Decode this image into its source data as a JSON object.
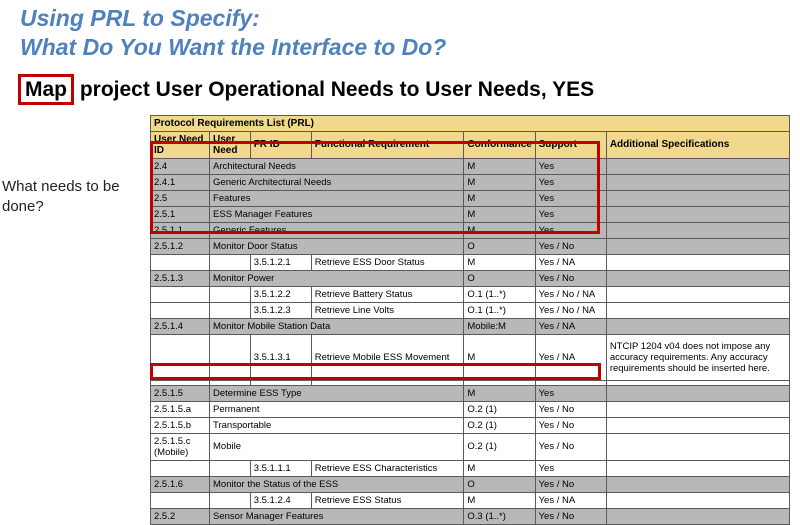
{
  "title": {
    "line1": "Using PRL to Specify:",
    "line2": "What Do You Want the Interface to Do?"
  },
  "subtitle": {
    "boxed": "Map",
    "rest": " project User Operational Needs to User Needs, YES"
  },
  "question": "What needs to be done?",
  "table": {
    "superheader": "Protocol Requirements List (PRL)",
    "columns": [
      "User Need ID",
      "User Need",
      "FR ID",
      "Functional Requirement",
      "Conformance",
      "Support",
      "Additional Specifications"
    ],
    "rows": [
      {
        "style": "shaded",
        "id": "2.4",
        "need": "Architectural Needs",
        "frid": "",
        "fr": "",
        "conf": "M",
        "sup": "Yes",
        "spec": ""
      },
      {
        "style": "shaded",
        "id": "2.4.1",
        "need": "Generic Architectural Needs",
        "frid": "",
        "fr": "",
        "conf": "M",
        "sup": "Yes",
        "spec": ""
      },
      {
        "style": "shaded",
        "id": "2.5",
        "need": "Features",
        "frid": "",
        "fr": "",
        "conf": "M",
        "sup": "Yes",
        "spec": ""
      },
      {
        "style": "shaded",
        "id": "2.5.1",
        "need": "ESS Manager Features",
        "frid": "",
        "fr": "",
        "conf": "M",
        "sup": "Yes",
        "spec": ""
      },
      {
        "style": "shaded",
        "id": "2.5.1.1",
        "need": "Generic Features",
        "frid": "",
        "fr": "",
        "conf": "M",
        "sup": "Yes",
        "spec": ""
      },
      {
        "style": "shaded",
        "id": "2.5.1.2",
        "need": "Monitor Door Status",
        "frid": "",
        "fr": "",
        "conf": "O",
        "sup": "Yes / No",
        "spec": ""
      },
      {
        "style": "white",
        "id": "",
        "need": "",
        "frid": "3.5.1.2.1",
        "fr": "Retrieve ESS Door Status",
        "conf": "M",
        "sup": "Yes / NA",
        "spec": ""
      },
      {
        "style": "shaded",
        "id": "2.5.1.3",
        "need": "Monitor Power",
        "frid": "",
        "fr": "",
        "conf": "O",
        "sup": "Yes / No",
        "spec": ""
      },
      {
        "style": "white",
        "id": "",
        "need": "",
        "frid": "3.5.1.2.2",
        "fr": "Retrieve Battery Status",
        "conf": "O.1 (1..*)",
        "sup": "Yes / No / NA",
        "spec": ""
      },
      {
        "style": "white",
        "id": "",
        "need": "",
        "frid": "3.5.1.2.3",
        "fr": "Retrieve Line Volts",
        "conf": "O.1 (1..*)",
        "sup": "Yes / No / NA",
        "spec": ""
      },
      {
        "style": "shaded",
        "id": "2.5.1.4",
        "need": "Monitor Mobile Station Data",
        "frid": "",
        "fr": "",
        "conf": "Mobile:M",
        "sup": "Yes / NA",
        "spec": ""
      },
      {
        "style": "white",
        "id": "",
        "need": "",
        "frid": "3.5.1.3.1",
        "fr": "Retrieve Mobile ESS Movement",
        "conf": "M",
        "sup": "Yes / NA",
        "spec": "NTCIP 1204 v04 does not impose any accuracy requirements. Any accuracy requirements should be inserted here.",
        "tall": true
      },
      {
        "style": "white",
        "id": "",
        "need": "",
        "frid": "",
        "fr": "",
        "conf": "",
        "sup": "",
        "spec": ""
      },
      {
        "style": "shaded",
        "id": "2.5.1.5",
        "need": "Determine ESS Type",
        "frid": "",
        "fr": "",
        "conf": "M",
        "sup": "Yes",
        "spec": ""
      },
      {
        "style": "white",
        "id": "2.5.1.5.a",
        "need": "Permanent",
        "frid": "",
        "fr": "",
        "conf": "O.2 (1)",
        "sup": "Yes / No",
        "spec": ""
      },
      {
        "style": "white",
        "id": "2.5.1.5.b",
        "need": "Transportable",
        "frid": "",
        "fr": "",
        "conf": "O.2 (1)",
        "sup": "Yes / No",
        "spec": ""
      },
      {
        "style": "white",
        "id": "2.5.1.5.c (Mobile)",
        "need": "Mobile",
        "frid": "",
        "fr": "",
        "conf": "O.2 (1)",
        "sup": "Yes / No",
        "spec": ""
      },
      {
        "style": "white",
        "id": "",
        "need": "",
        "frid": "3.5.1.1.1",
        "fr": "Retrieve ESS Characteristics",
        "conf": "M",
        "sup": "Yes",
        "spec": ""
      },
      {
        "style": "shaded",
        "id": "2.5.1.6",
        "need": "Monitor the Status of the ESS",
        "frid": "",
        "fr": "",
        "conf": "O",
        "sup": "Yes / No",
        "spec": ""
      },
      {
        "style": "white",
        "id": "",
        "need": "",
        "frid": "3.5.1.2.4",
        "fr": "Retrieve ESS Status",
        "conf": "M",
        "sup": "Yes / NA",
        "spec": ""
      },
      {
        "style": "shaded",
        "id": "2.5.2",
        "need": "Sensor Manager Features",
        "frid": "",
        "fr": "",
        "conf": "O.3 (1..*)",
        "sup": "Yes / No",
        "spec": ""
      }
    ]
  }
}
